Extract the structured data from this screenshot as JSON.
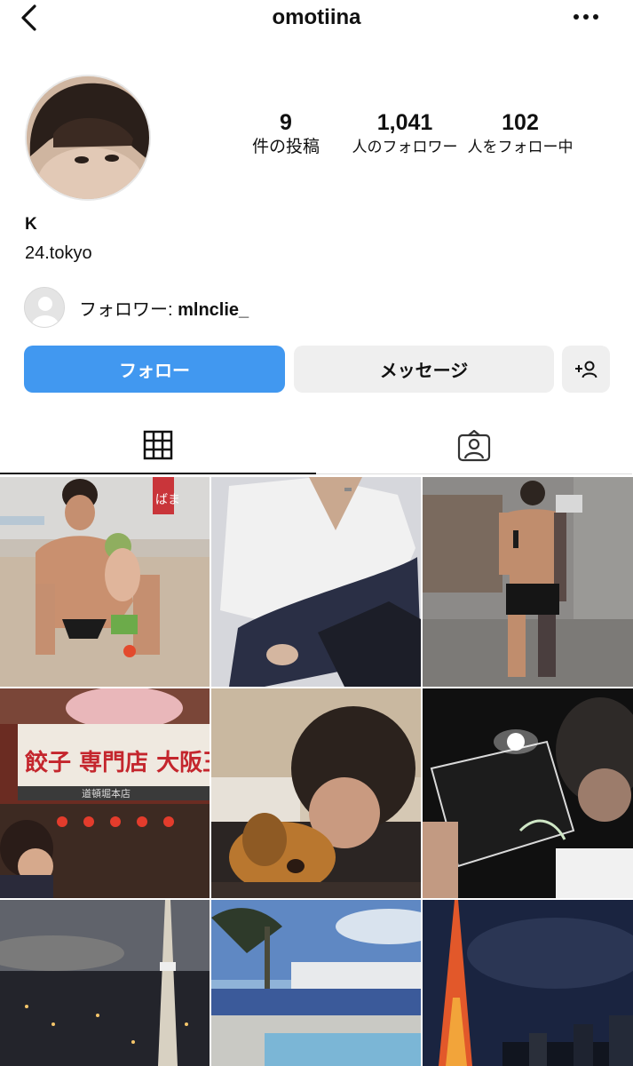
{
  "header": {
    "username": "omotiina",
    "back_icon": "chevron-left-icon",
    "more_icon": "more-horizontal-icon"
  },
  "profile": {
    "display_name": "K",
    "bio": "24.tokyo"
  },
  "stats": {
    "posts_count": "9",
    "posts_label": "件の投稿",
    "followers_count": "1,041",
    "followers_label": "人のフォロワー",
    "following_count": "102",
    "following_label": "人をフォロー中"
  },
  "followed_by": {
    "prefix": "フォロワー: ",
    "username": "mlnclie_"
  },
  "actions": {
    "follow_label": "フォロー",
    "message_label": "メッセージ",
    "add_user_icon": "add-person-icon"
  },
  "tabs": [
    {
      "icon": "grid-icon",
      "active": true
    },
    {
      "icon": "tagged-person-icon",
      "active": false
    }
  ],
  "photos": {
    "sign_text": "ばま",
    "shop_sign": "餃子 専門店 大阪王",
    "shop_sub": "道頓堀本店"
  },
  "colors": {
    "accent": "#4198f0",
    "button_gray": "#efefef"
  }
}
